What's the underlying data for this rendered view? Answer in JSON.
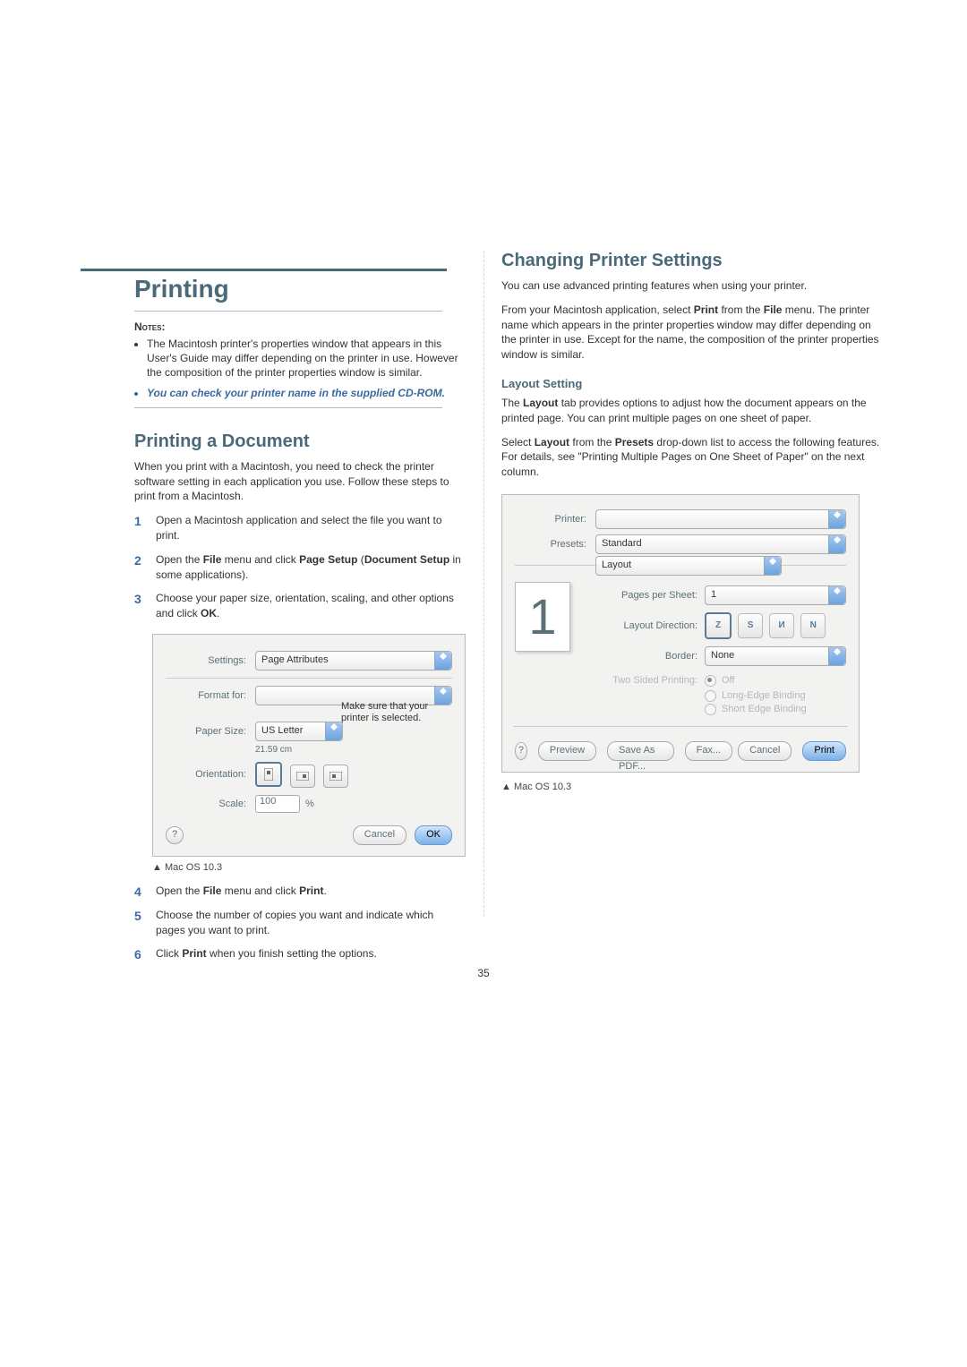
{
  "page_number": "35",
  "left": {
    "title": "Printing",
    "notes_label": "Notes:",
    "notes": [
      "The Macintosh printer's properties window that appears in this User's Guide may differ depending on the printer in use. However the composition of the printer properties window is similar.",
      "You can check your printer name in the supplied CD-ROM."
    ],
    "sec1_title": "Printing a Document",
    "sec1_intro": "When you print with a Macintosh, you need to check the printer software setting in each application you use. Follow these steps to print from a Macintosh.",
    "steps_a": [
      "Open a Macintosh application and select the file you want to print.",
      "Open the File menu and click Page Setup (Document Setup in some applications).",
      "Choose your paper size, orientation, scaling, and other options and click OK."
    ],
    "fig1": {
      "settings_label": "Settings:",
      "settings_value": "Page Attributes",
      "format_label": "Format for:",
      "paper_label": "Paper Size:",
      "paper_value": "US Letter",
      "paper_sub": "21.59 cm",
      "callout": "Make sure that your printer is selected.",
      "orientation_label": "Orientation:",
      "scale_label": "Scale:",
      "scale_value": "100",
      "scale_unit": "%",
      "cancel": "Cancel",
      "ok": "OK"
    },
    "caption1": "Mac OS 10.3",
    "steps_b": [
      "Open the File menu and click Print.",
      "Choose the number of copies you want and indicate which pages you want to print.",
      "Click Print when you finish setting the options."
    ]
  },
  "right": {
    "title": "Changing Printer Settings",
    "p1": "You can use advanced printing features when using your printer.",
    "p2": "From your Macintosh application, select Print from the File menu. The printer name which appears in the printer properties window may differ depending on the printer in use. Except for the name, the composition of the printer properties window is similar.",
    "sub1": "Layout Setting",
    "p3": "The Layout tab provides options to adjust how the document appears on the printed page. You can print multiple pages on one sheet of paper.",
    "p4": "Select Layout from the Presets drop-down list to access the following features. For details, see \"Printing Multiple Pages on One Sheet of Paper\" on the next column.",
    "fig2": {
      "printer_label": "Printer:",
      "presets_label": "Presets:",
      "presets_value": "Standard",
      "section_value": "Layout",
      "pps_label": "Pages per Sheet:",
      "pps_value": "1",
      "dir_label": "Layout Direction:",
      "border_label": "Border:",
      "border_value": "None",
      "tsp_label": "Two Sided Printing:",
      "tsp_opts": [
        "Off",
        "Long-Edge Binding",
        "Short Edge Binding"
      ],
      "preview_value": "1",
      "preview_btn": "Preview",
      "save_pdf": "Save As PDF...",
      "fax": "Fax...",
      "cancel": "Cancel",
      "print": "Print"
    },
    "caption2": "Mac OS 10.3"
  }
}
